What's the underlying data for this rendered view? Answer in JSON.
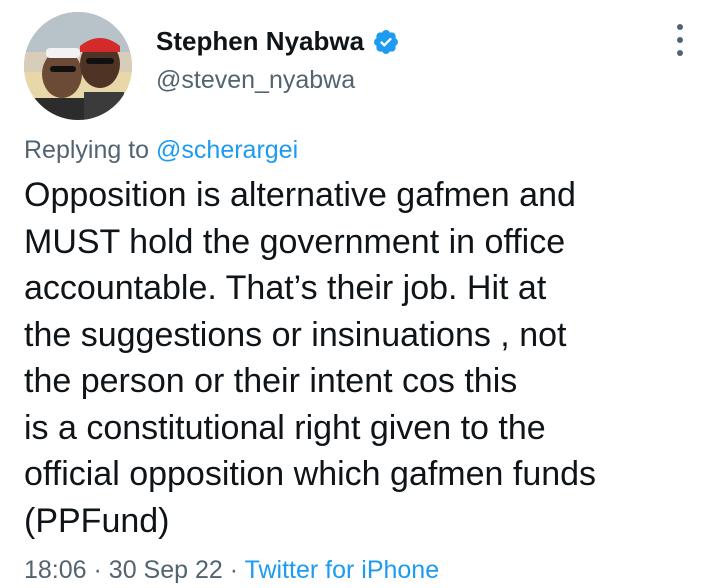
{
  "author": {
    "display_name": "Stephen Nyabwa",
    "handle": "@steven_nyabwa",
    "verified_icon": "verified-badge-icon",
    "avatar": "profile photo of two men in sunglasses and caps"
  },
  "reply": {
    "prefix": "Replying to",
    "mention": "@scherargei"
  },
  "tweet": {
    "lines": [
      "Opposition is alternative gafmen and",
      "MUST hold the government in office",
      "accountable. That’s their job. Hit at",
      "the suggestions or insinuations , not",
      "the person or their intent cos this",
      "is a constitutional right given to the",
      "official opposition which gafmen funds",
      "(PPFund)"
    ]
  },
  "meta": {
    "time": "18:06",
    "separator": "·",
    "date": "30 Sep 22",
    "source": "Twitter for iPhone"
  },
  "colors": {
    "text": "#0f1419",
    "secondary": "#536471",
    "accent": "#1d9bf0"
  }
}
